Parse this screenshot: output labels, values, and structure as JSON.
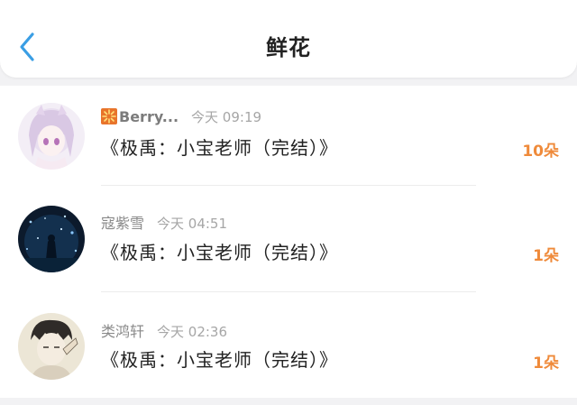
{
  "header": {
    "title": "鲜花",
    "back_icon": "chevron-left-icon",
    "accent": "#3a9ee4"
  },
  "flowers": [
    {
      "name": "Berry...",
      "name_icon": "firework-icon",
      "time": "今天 09:19",
      "book": "《极禹：小宝老师（完结）》",
      "count": "10朵"
    },
    {
      "name": "寇紫雪",
      "time": "今天 04:51",
      "book": "《极禹：小宝老师（完结）》",
      "count": "1朵"
    },
    {
      "name": "类鸿轩",
      "time": "今天 02:36",
      "book": "《极禹：小宝老师（完结）》",
      "count": "1朵"
    }
  ],
  "colors": {
    "count": "#ef8a3a",
    "title": "#222222"
  }
}
